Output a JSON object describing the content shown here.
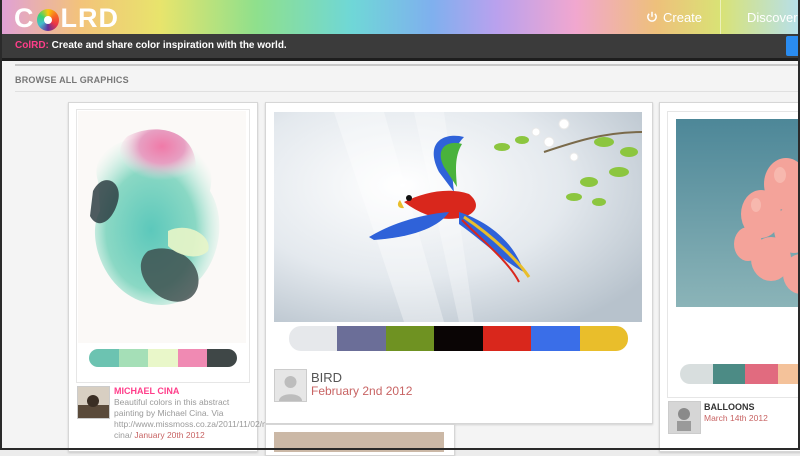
{
  "header": {
    "logo_text_1": "C",
    "logo_text_2": "LRD",
    "create_label": "Create",
    "discover_label": "Discover"
  },
  "tagline": {
    "brand": "ColRD:",
    "text": " Create and share color inspiration with the world."
  },
  "section": {
    "title": "BROWSE ALL GRAPHICS"
  },
  "cards": [
    {
      "title": "MICHAEL CINA",
      "description": "Beautiful colors in this abstract painting by Michael Cina. Via http://www.missmoss.co.za/2011/11/02/michael-cina/",
      "date": "January 20th 2012",
      "palette": [
        "#6cc3b1",
        "#a5dfb7",
        "#e9f7c9",
        "#f08ab3",
        "#3f4747"
      ]
    },
    {
      "title": "BIRD",
      "date": "February 2nd 2012",
      "palette": [
        "#e6e8eb",
        "#6b6e98",
        "#6f9222",
        "#0a0505",
        "#d9271c",
        "#3a6ee8",
        "#e9be2b"
      ]
    },
    {
      "title": "BALLOONS",
      "date": "March 14th 2012",
      "palette": [
        "#d8dede",
        "#4c8b85",
        "#e16b7f",
        "#f4c29a"
      ]
    }
  ],
  "colors": {
    "accent_pink": "#ff3e8a",
    "date_red": "#c86464",
    "button_blue": "#2a8cf0"
  },
  "icons": [
    "logo-color-wheel-icon",
    "power-icon",
    "bird-avatar-icon",
    "user-avatar-icon",
    "balloons-avatar-icon"
  ]
}
